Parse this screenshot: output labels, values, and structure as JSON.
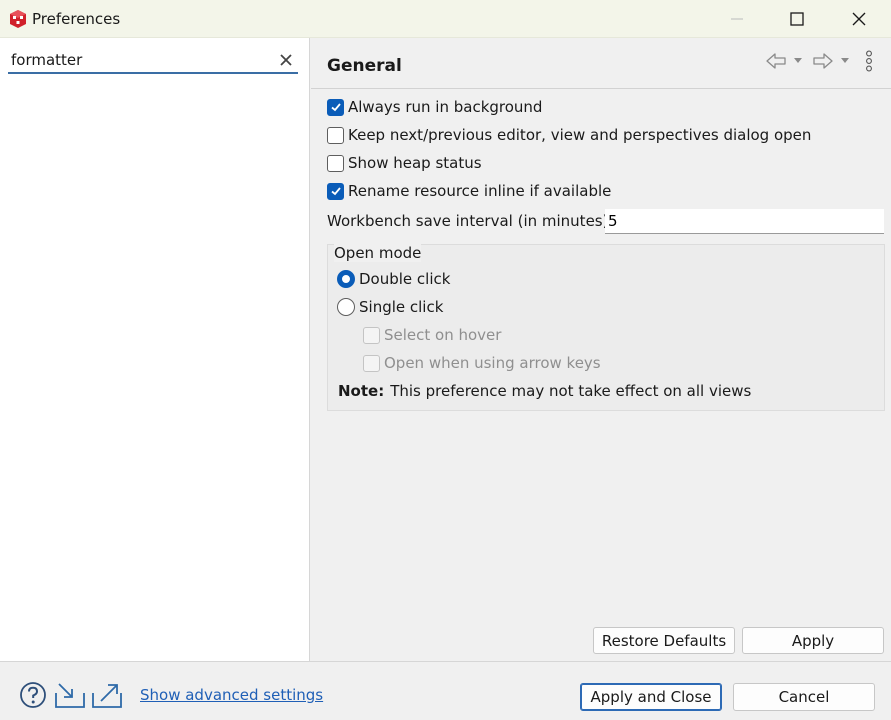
{
  "window": {
    "title": "Preferences"
  },
  "icons": {
    "app": "preferences-app-icon",
    "minimize": "minimize-icon",
    "maximize": "maximize-icon",
    "close": "close-icon",
    "clear": "clear-filter-icon",
    "back": "back-arrow-icon",
    "forward": "forward-arrow-icon",
    "menu": "kebab-menu-icon",
    "help": "help-icon",
    "import": "import-icon",
    "export": "export-icon"
  },
  "colors": {
    "accent": "#0a5cb8",
    "link": "#1f5fb6",
    "app_icon": "#d0202a"
  },
  "filter": {
    "value": "formatter"
  },
  "page": {
    "title": "General",
    "checkboxes": [
      {
        "label": "Always run in background",
        "checked": true
      },
      {
        "label": "Keep next/previous editor, view and perspectives dialog open",
        "checked": false
      },
      {
        "label": "Show heap status",
        "checked": false
      },
      {
        "label": "Rename resource inline if available",
        "checked": true
      }
    ],
    "interval": {
      "label": "Workbench save interval (in minutes):",
      "value": "5"
    },
    "open_mode": {
      "title": "Open mode",
      "options": [
        {
          "label": "Double click",
          "selected": true
        },
        {
          "label": "Single click",
          "selected": false
        }
      ],
      "sub_options": [
        {
          "label": "Select on hover",
          "checked": false,
          "enabled": false
        },
        {
          "label": "Open when using arrow keys",
          "checked": false,
          "enabled": false
        }
      ],
      "note_label": "Note:",
      "note_text": "This preference may not take effect on all views"
    },
    "restore_defaults": "Restore Defaults",
    "apply": "Apply"
  },
  "footer": {
    "advanced_link": "Show advanced settings",
    "apply_and_close": "Apply and Close",
    "cancel": "Cancel"
  }
}
